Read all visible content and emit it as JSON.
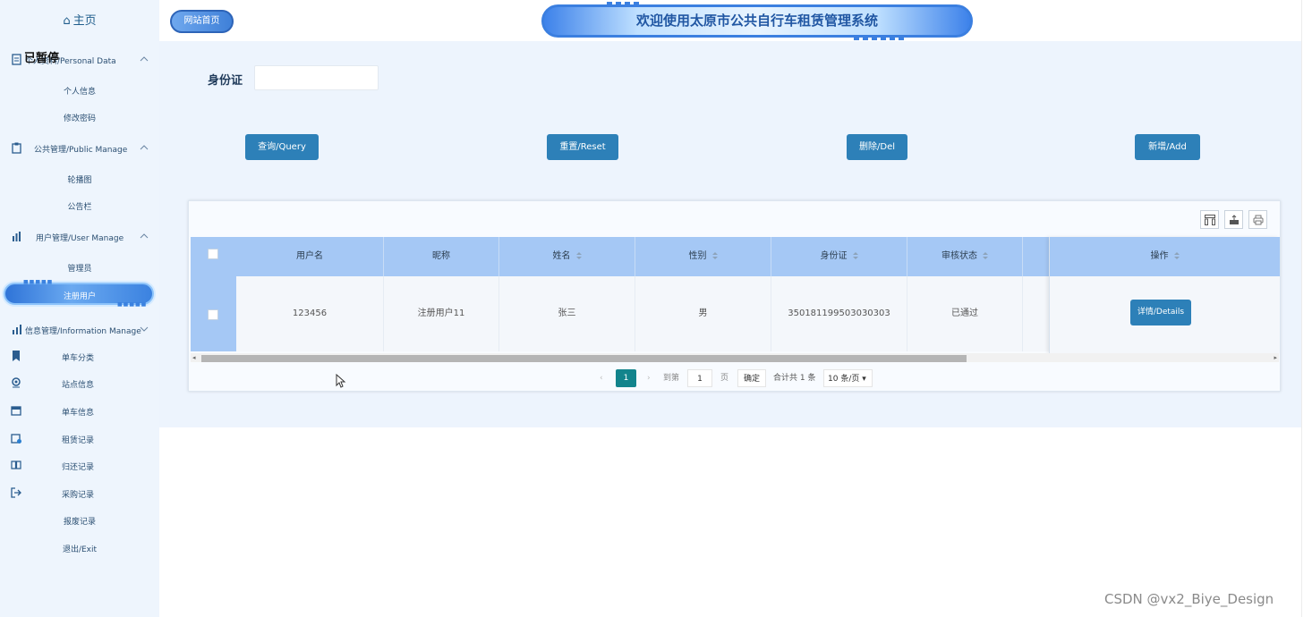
{
  "sidebar": {
    "home_label": "主页",
    "overlay_label": "已暂停",
    "groups": [
      {
        "label": "个人资料/Personal Data",
        "items": [
          "个人信息",
          "修改密码"
        ]
      },
      {
        "label": "公共管理/Public Manage",
        "items": [
          "轮播图",
          "公告栏"
        ]
      },
      {
        "label": "用户管理/User Manage",
        "items": [
          "管理员",
          "注册用户"
        ]
      },
      {
        "label": "信息管理/Information Manage",
        "items": [
          "单车分类",
          "站点信息",
          "单车信息",
          "租赁记录",
          "归还记录",
          "采购记录",
          "报废记录",
          "退出/Exit"
        ]
      }
    ],
    "active_item": "注册用户"
  },
  "header": {
    "site_home": "网站首页",
    "banner_title": "欢迎使用太原市公共自行车租赁管理系统"
  },
  "search": {
    "id_label": "身份证",
    "id_value": ""
  },
  "actions": {
    "query": "查询/Query",
    "reset": "重置/Reset",
    "delete": "删除/Del",
    "add": "新增/Add"
  },
  "table": {
    "columns": [
      "用户名",
      "昵称",
      "姓名",
      "性别",
      "身份证",
      "审核状态",
      "操作"
    ],
    "rows": [
      {
        "username": "123456",
        "nickname": "注册用户11",
        "name": "张三",
        "gender": "男",
        "id_card": "350181199503030303",
        "status": "已通过",
        "action": "详情/Details"
      }
    ]
  },
  "pager": {
    "current": "1",
    "goto_label": "到第",
    "goto_value": "1",
    "page_unit": "页",
    "confirm": "确定",
    "total": "合计共 1 条",
    "page_size": "10 条/页"
  },
  "watermark": "CSDN @vx2_Biye_Design",
  "colors": {
    "accent": "#2d80b8",
    "header_row": "#a5c8f5",
    "pager_current": "#12848c"
  }
}
